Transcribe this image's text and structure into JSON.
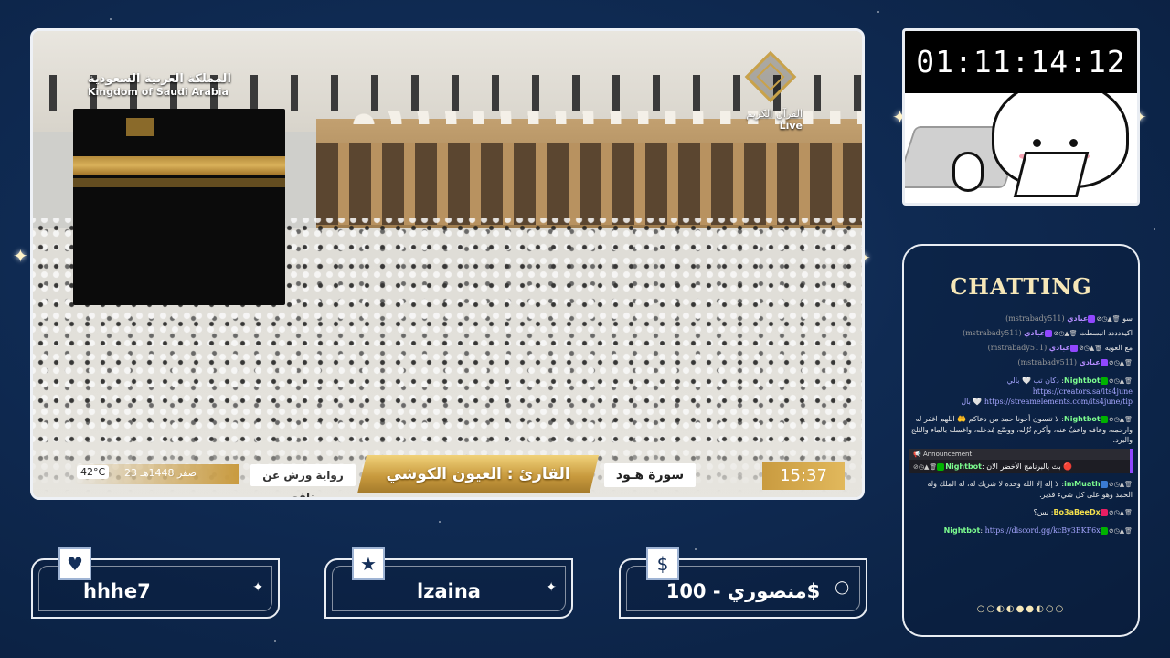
{
  "video": {
    "ksa_logo_ar": "المملكة العربية السعودية",
    "ksa_logo_en": "Kingdom of Saudi Arabia",
    "channel_name": "القرآن الكريم",
    "channel_live": "Live",
    "temperature": "42°C",
    "hijri_date": "23 صفر 1448هـ",
    "riwaya": "رواية ورش عن نافع",
    "reader": "القارئ : العيون الكوشي",
    "surah": "سورة هـود",
    "clock": "15:37"
  },
  "timer": {
    "value": "01:11:14:12"
  },
  "chat": {
    "title": "CHATTING",
    "messages": [
      {
        "user": "عبادي",
        "handle": "(mstrabady511)",
        "text": "سو",
        "badge_color": "#9147ff"
      },
      {
        "user": "عبادي",
        "handle": "(mstrabady511)",
        "text": "اكيددددد انبسطت",
        "badge_color": "#9147ff"
      },
      {
        "user": "عبادي",
        "handle": "(mstrabady511)",
        "text": "مع العويه",
        "badge_color": "#9147ff"
      },
      {
        "user": "عبادي",
        "handle": "(mstrabady511)",
        "text": "",
        "badge_color": "#9147ff"
      },
      {
        "user": "Nightbot",
        "handle": "",
        "text": "دكان تب 🤍 بالي https://creators.sa/its4june https://streamelements.com/its4june/tip 🤍 بال",
        "badge_color": "#00b300"
      },
      {
        "user": "Nightbot",
        "handle": "",
        "text": "لا تنسون أخونا حمد من دعاكم 🤲 اللهم اغفر له وارحمه، وعافه واعفُ عنه، وأكرم نُزُله، ووسّع مُدخله، واغسله بالماء والثلج والبرد.",
        "badge_color": "#00b300"
      }
    ],
    "announcement_label": "Announcement",
    "announcement": {
      "user": "Nightbot",
      "text": "بث بالبرنامج الأخضر الان 🔴"
    },
    "messages_after": [
      {
        "user": "imMuath",
        "handle": "",
        "text": "لا إله إلا الله وحده لا شريك له، له الملك وله الحمد وهو على كل شيء قدير.",
        "badge_color": "#3a7bd5"
      },
      {
        "user": "Bo3aBeeDx",
        "handle": "",
        "text": "نس؟",
        "badge_color": "#e91e63"
      },
      {
        "user": "Nightbot",
        "handle": "",
        "text": "https://discord.gg/kcBy3EKF6x",
        "badge_color": "#00b300"
      }
    ],
    "pager_dots": "○○◐◐●●◐○○"
  },
  "alerts": [
    {
      "icon": "heart-icon",
      "glyph": "♥",
      "text": "hhhe7"
    },
    {
      "icon": "star-icon",
      "glyph": "★",
      "text": "lzaina"
    },
    {
      "icon": "dollar-icon",
      "glyph": "$",
      "text": "منصوري - 100$"
    }
  ]
}
